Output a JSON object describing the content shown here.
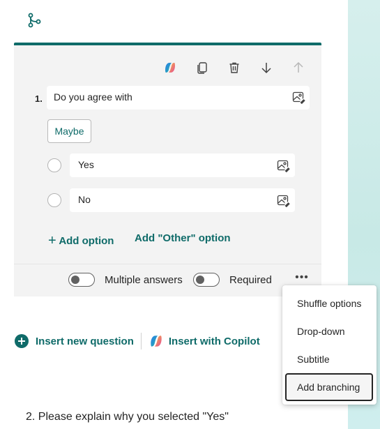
{
  "icons": {
    "branching": "branching-icon",
    "copilot": "copilot-icon",
    "copy": "copy-icon",
    "delete": "delete-icon",
    "move_down": "arrow-down-icon",
    "move_up": "arrow-up-icon",
    "image": "image-icon",
    "more": "more-options-icon",
    "add": "plus-icon"
  },
  "colors": {
    "accent": "#0f6b69",
    "panel_bg": "#d6efed",
    "card_bg": "#f3f3f3"
  },
  "question": {
    "number": "1.",
    "title": "Do you agree with",
    "suggestion_chip": "Maybe",
    "options": [
      {
        "label": "Yes"
      },
      {
        "label": "No"
      }
    ],
    "add_option_label": "Add option",
    "add_other_label": "Add \"Other\" option",
    "multiple_answers_label": "Multiple answers",
    "required_label": "Required",
    "more_label": "•••"
  },
  "menu": {
    "items": [
      {
        "label": "Shuffle options"
      },
      {
        "label": "Drop-down"
      },
      {
        "label": "Subtitle"
      },
      {
        "label": "Add branching"
      }
    ]
  },
  "insert": {
    "new_question_label": "Insert new question",
    "copilot_label": "Insert with Copilot"
  },
  "next_question": {
    "text": "2. Please explain why you selected \"Yes\""
  }
}
